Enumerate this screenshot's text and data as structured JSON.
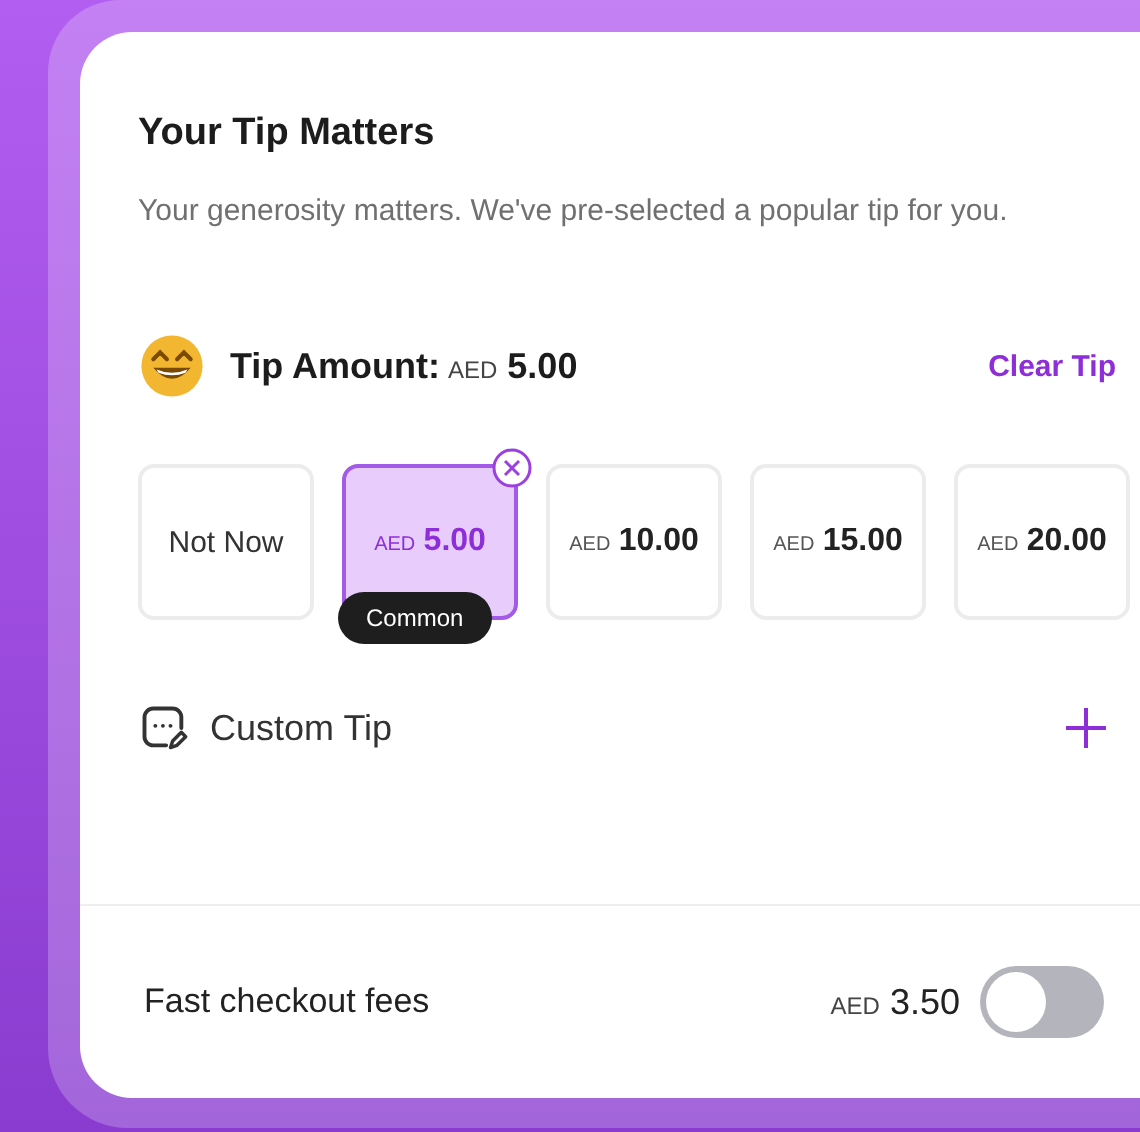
{
  "title": "Your Tip Matters",
  "description": "Your generosity matters. We've pre-selected a popular tip for you.",
  "tip_amount": {
    "label": "Tip Amount:",
    "currency": "AED",
    "amount": "5.00"
  },
  "clear_link": "Clear Tip",
  "options": [
    {
      "kind": "none",
      "label": "Not Now",
      "selected": false
    },
    {
      "kind": "amount",
      "currency": "AED",
      "amount": "5.00",
      "selected": true,
      "badge": "Common"
    },
    {
      "kind": "amount",
      "currency": "AED",
      "amount": "10.00",
      "selected": false
    },
    {
      "kind": "amount",
      "currency": "AED",
      "amount": "15.00",
      "selected": false
    },
    {
      "kind": "amount",
      "currency": "AED",
      "amount": "20.00",
      "selected": false
    }
  ],
  "custom_tip": {
    "label": "Custom Tip"
  },
  "fast_checkout": {
    "label": "Fast checkout fees",
    "currency": "AED",
    "amount": "3.50",
    "on": false
  }
}
